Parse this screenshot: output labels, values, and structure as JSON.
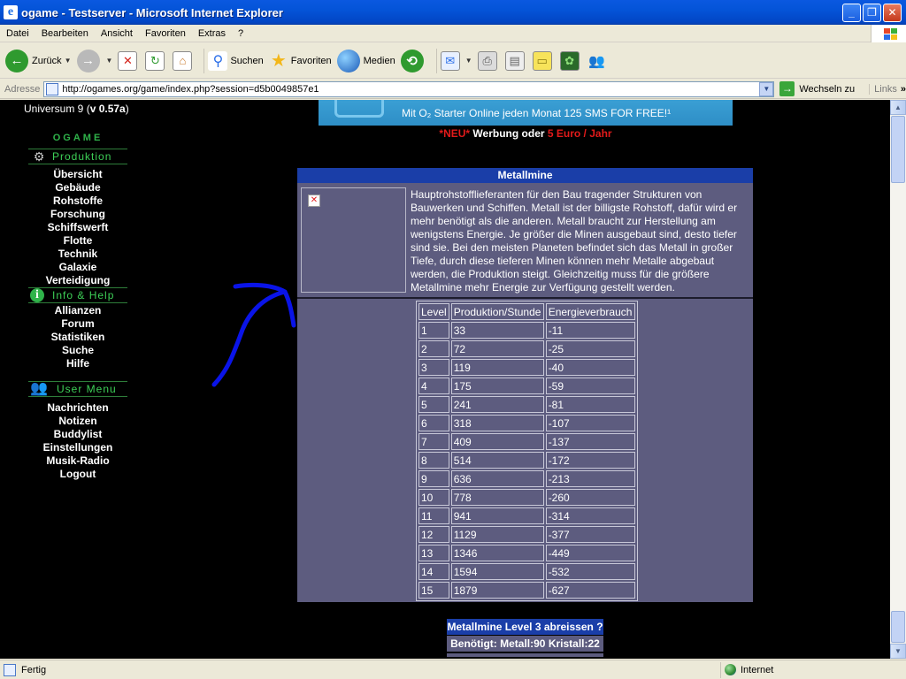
{
  "window": {
    "title": "ogame - Testserver - Microsoft Internet Explorer",
    "app_icon_glyph": "e",
    "controls": {
      "minimize": "_",
      "maximize": "❐",
      "close": "✕"
    }
  },
  "menubar": [
    "Datei",
    "Bearbeiten",
    "Ansicht",
    "Favoriten",
    "Extras",
    "?"
  ],
  "toolbar": {
    "back": "Zurück",
    "search": "Suchen",
    "favorites": "Favoriten",
    "media": "Medien"
  },
  "address": {
    "label": "Adresse",
    "url": "http://ogames.org/game/index.php?session=d5b0049857e1",
    "go": "Wechseln zu",
    "links": "Links",
    "chevron": "»"
  },
  "leftmenu": {
    "universe_prefix": "Universum 9 (",
    "universe_version": "v 0.57a",
    "universe_suffix": ")",
    "logo": "OGAME",
    "sections": {
      "produktion": "Produktion",
      "info": "Info & Help",
      "user": "User Menu"
    },
    "produktion_items": [
      "Übersicht",
      "Gebäude",
      "Rohstoffe",
      "Forschung",
      "Schiffswerft",
      "Flotte",
      "Technik",
      "Galaxie",
      "Verteidigung"
    ],
    "info_items": [
      "Allianzen",
      "Forum",
      "Statistiken",
      "Suche",
      "Hilfe"
    ],
    "user_items": [
      "Nachrichten",
      "Notizen",
      "Buddylist",
      "Einstellungen",
      "Musik-Radio",
      "Logout"
    ]
  },
  "banner": {
    "text": "Mit O₂ Starter Online jeden Monat 125 SMS FOR FREE!¹"
  },
  "adline": {
    "neu": "*NEU*",
    "middle": " Werbung oder ",
    "price": "5 Euro / Jahr"
  },
  "building": {
    "title": "Metallmine",
    "broken_image_glyph": "✕",
    "description": "Hauptrohstofflieferanten für den Bau tragender Strukturen von Bauwerken und Schiffen. Metall ist der billigste Rohstoff, dafür wird er mehr benötigt als die anderen. Metall braucht zur Herstellung am wenigstens Energie. Je größer die Minen ausgebaut sind, desto tiefer sind sie. Bei den meisten Planeten befindet sich das Metall in großer Tiefe, durch diese tieferen Minen können mehr Metalle abgebaut werden, die Produktion steigt. Gleichzeitig muss für die größere Metallmine mehr Energie zur Verfügung gestellt werden.",
    "table": {
      "headers": [
        "Level",
        "Produktion/Stunde",
        "Energieverbrauch"
      ],
      "rows": [
        [
          "1",
          "33",
          "-11"
        ],
        [
          "2",
          "72",
          "-25"
        ],
        [
          "3",
          "119",
          "-40"
        ],
        [
          "4",
          "175",
          "-59"
        ],
        [
          "5",
          "241",
          "-81"
        ],
        [
          "6",
          "318",
          "-107"
        ],
        [
          "7",
          "409",
          "-137"
        ],
        [
          "8",
          "514",
          "-172"
        ],
        [
          "9",
          "636",
          "-213"
        ],
        [
          "10",
          "778",
          "-260"
        ],
        [
          "11",
          "941",
          "-314"
        ],
        [
          "12",
          "1129",
          "-377"
        ],
        [
          "13",
          "1346",
          "-449"
        ],
        [
          "14",
          "1594",
          "-532"
        ],
        [
          "15",
          "1879",
          "-627"
        ]
      ]
    },
    "demolish_label": "Metallmine Level 3 abreissen ?",
    "requires_label": "Benötigt: Metall:90 Kristall:22"
  },
  "annotation": {
    "arrow_color": "#0a14e8"
  },
  "colors": {
    "panel_bg": "#5d5c7f",
    "header_blue": "#1a3ea8",
    "menu_green": "#3dcf57"
  },
  "statusbar": {
    "text": "Fertig",
    "zone": "Internet"
  }
}
